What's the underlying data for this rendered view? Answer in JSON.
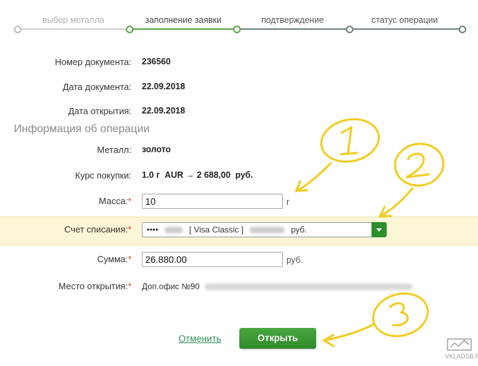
{
  "stepper": {
    "steps": [
      {
        "label": "выбор металла"
      },
      {
        "label": "заполнение заявки"
      },
      {
        "label": "подтверждение"
      },
      {
        "label": "статус операции"
      }
    ],
    "active_index": 1,
    "colors": {
      "done": "#d0d0d0",
      "active": "#5aa84a",
      "pending": "#6e7f86"
    }
  },
  "document": {
    "number_label": "Номер документа:",
    "number_value": "236560",
    "date_label": "Дата документа:",
    "date_value": "22.09.2018",
    "open_date_label": "Дата открытия:",
    "open_date_value": "22.09.2018"
  },
  "operation": {
    "section_title": "Информация об операции",
    "metal_label": "Металл:",
    "metal_value": "золото",
    "rate_label": "Курс покупки:",
    "rate_value": "1.0 г  AUR → 2 688,00  руб.",
    "mass_label": "Масса:",
    "mass_value": "10",
    "mass_unit": "г",
    "account_label": "Счет списания:",
    "account_prefix": "••••",
    "account_card": "[ Visa Classic ]",
    "account_currency": "руб.",
    "sum_label": "Сумма:",
    "sum_value": "26.880.00",
    "sum_unit": "руб.",
    "place_label": "Место открытия:",
    "place_value": "Доп.офис №90"
  },
  "required_mark": "*",
  "actions": {
    "cancel_label": "Отменить",
    "open_label": "Открыть"
  },
  "annotations": {
    "color": "#f2cc1f",
    "numbers": [
      "1",
      "2",
      "3"
    ]
  },
  "watermark": {
    "text": "VKLADSB.RU"
  }
}
